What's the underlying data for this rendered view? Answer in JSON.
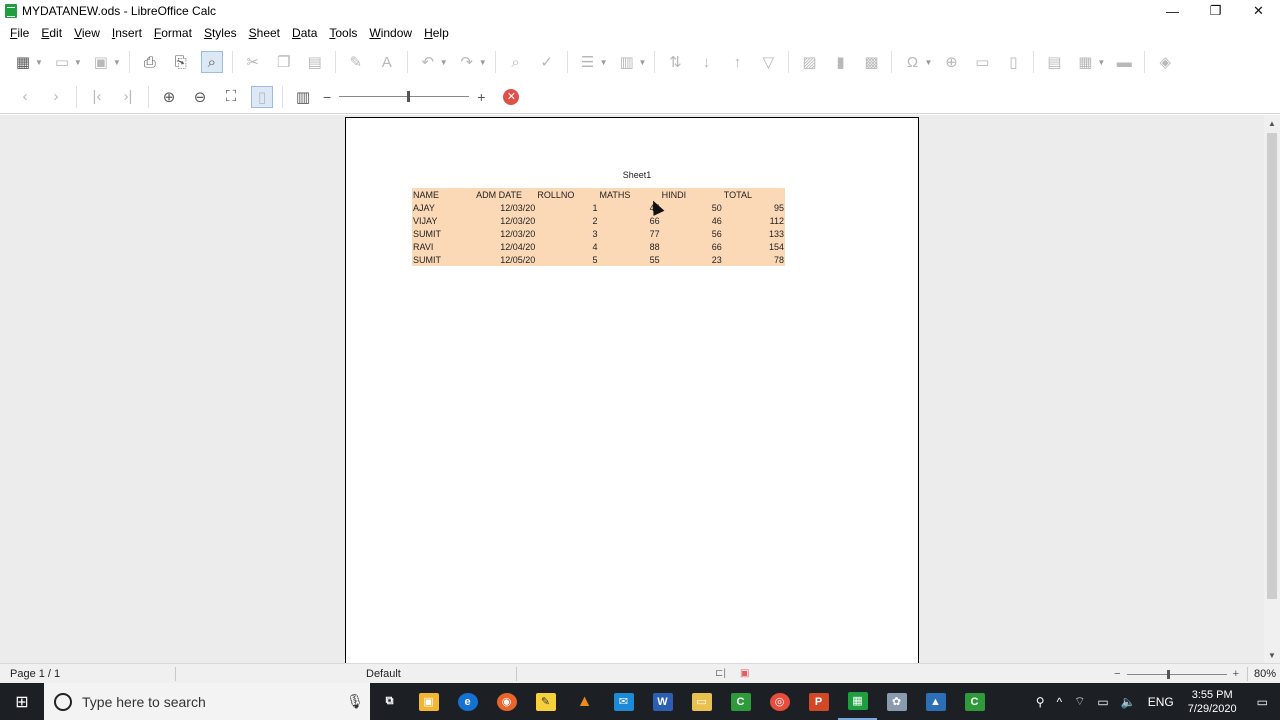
{
  "window": {
    "title": "MYDATANEW.ods - LibreOffice Calc",
    "minimize": "—",
    "restore": "❐",
    "close": "✕"
  },
  "menu": [
    "File",
    "Edit",
    "View",
    "Insert",
    "Format",
    "Styles",
    "Sheet",
    "Data",
    "Tools",
    "Window",
    "Help"
  ],
  "preview": {
    "sheet_name": "Sheet1",
    "headers": [
      "NAME",
      "ADM DATE",
      "ROLLNO",
      "MATHS",
      "HINDI",
      "TOTAL"
    ],
    "rows": [
      [
        "AJAY",
        "12/03/20",
        "1",
        "45",
        "50",
        "95"
      ],
      [
        "VIJAY",
        "12/03/20",
        "2",
        "66",
        "46",
        "112"
      ],
      [
        "SUMIT",
        "12/03/20",
        "3",
        "77",
        "56",
        "133"
      ],
      [
        "RAVI",
        "12/04/20",
        "4",
        "88",
        "66",
        "154"
      ],
      [
        "SUMIT",
        "12/05/20",
        "5",
        "55",
        "23",
        "78"
      ]
    ],
    "table_bg": "#fbd9b6"
  },
  "status": {
    "page": "Page 1 / 1",
    "style": "Default",
    "zoom": "80%"
  },
  "taskbar": {
    "search_placeholder": "Type here to search",
    "lang": "ENG",
    "time": "3:55 PM",
    "date": "7/29/2020"
  }
}
